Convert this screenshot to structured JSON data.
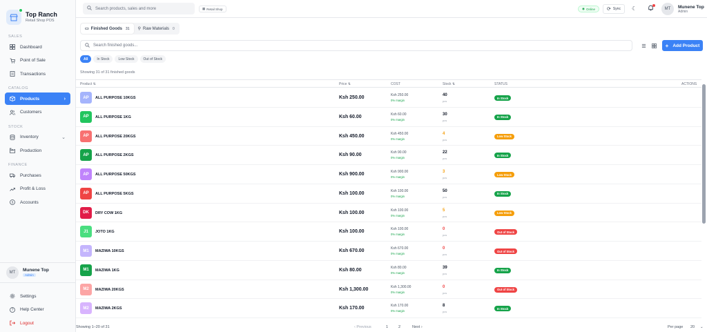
{
  "brand": {
    "title": "Top Ranch",
    "subtitle": "Retail Shop POS"
  },
  "sidebar": {
    "sections": [
      {
        "label": "SALES",
        "items": [
          {
            "label": "Dashboard",
            "icon": "dashboard-icon"
          },
          {
            "label": "Point of Sale",
            "icon": "cart-icon"
          },
          {
            "label": "Transactions",
            "icon": "receipt-icon"
          }
        ]
      },
      {
        "label": "CATALOG",
        "items": [
          {
            "label": "Products",
            "icon": "box-icon",
            "active": true
          },
          {
            "label": "Customers",
            "icon": "users-icon"
          }
        ]
      },
      {
        "label": "STOCK",
        "items": [
          {
            "label": "Inventory",
            "icon": "database-icon"
          },
          {
            "label": "Production",
            "icon": "factory-icon"
          }
        ]
      },
      {
        "label": "FINANCE",
        "items": [
          {
            "label": "Purchases",
            "icon": "truck-icon"
          },
          {
            "label": "Profit & Loss",
            "icon": "trend-icon"
          },
          {
            "label": "Accounts",
            "icon": "dollar-icon"
          }
        ]
      }
    ],
    "user": {
      "initials": "MT",
      "name": "Munene Top",
      "role": "Admin"
    },
    "bottom": {
      "settings": "Settings",
      "help": "Help Center",
      "logout": "Logout"
    }
  },
  "topbar": {
    "search_placeholder": "Search products, sales and more",
    "shop": "Retail Shop",
    "online": "Online",
    "sync": "Sync",
    "user": {
      "initials": "MT",
      "name": "Munene Top",
      "role": "Admin"
    }
  },
  "tabs": [
    {
      "label": "Finished Goods",
      "count": "31"
    },
    {
      "label": "Raw Materials",
      "count": "0"
    }
  ],
  "toolbar": {
    "search_placeholder": "Search finished goods...",
    "add_label": "Add Product"
  },
  "filters": [
    "All",
    "In Stock",
    "Low Stock",
    "Out of Stock"
  ],
  "showing_text": "Showing 31 of 31 finished goods",
  "table": {
    "headers": {
      "product": "Product ⇅",
      "price": "Price ⇅",
      "cost": "COST",
      "stock": "Stock ⇅",
      "status": "STATUS",
      "actions": "ACTIONS"
    },
    "rows": [
      {
        "initials": "AP",
        "color": "#a5b4fc",
        "name": "ALL PURPOSE 10KGS",
        "price": "Ksh 250.00",
        "cost": "Ksh 250.00",
        "margin": "0% margin",
        "stock": "40",
        "stock_color": "#111827",
        "unit": "pcs",
        "status": "In Stock",
        "status_color": "#16a34a"
      },
      {
        "initials": "AP",
        "color": "#22c55e",
        "name": "ALL PURPOSE 1KG",
        "price": "Ksh 60.00",
        "cost": "Ksh 60.00",
        "margin": "0% margin",
        "stock": "30",
        "stock_color": "#111827",
        "unit": "pcs",
        "status": "In Stock",
        "status_color": "#16a34a"
      },
      {
        "initials": "AP",
        "color": "#f87171",
        "name": "ALL PURPOSE 20KGS",
        "price": "Ksh 450.00",
        "cost": "Ksh 450.00",
        "margin": "0% margin",
        "stock": "4",
        "stock_color": "#f59e0b",
        "unit": "pcs",
        "status": "Low Stock",
        "status_color": "#f59e0b"
      },
      {
        "initials": "AP",
        "color": "#16a34a",
        "name": "ALL PURPOSE 2KGS",
        "price": "Ksh 90.00",
        "cost": "Ksh 90.00",
        "margin": "0% margin",
        "stock": "22",
        "stock_color": "#111827",
        "unit": "pcs",
        "status": "In Stock",
        "status_color": "#16a34a"
      },
      {
        "initials": "AP",
        "color": "#c084fc",
        "name": "ALL PURPOSE 50KGS",
        "price": "Ksh 900.00",
        "cost": "Ksh 900.00",
        "margin": "0% margin",
        "stock": "3",
        "stock_color": "#f59e0b",
        "unit": "pcs",
        "status": "Low Stock",
        "status_color": "#f59e0b"
      },
      {
        "initials": "AP",
        "color": "#ef4444",
        "name": "ALL PURPOSE 5KGS",
        "price": "Ksh 100.00",
        "cost": "Ksh 100.00",
        "margin": "0% margin",
        "stock": "50",
        "stock_color": "#111827",
        "unit": "pcs",
        "status": "In Stock",
        "status_color": "#16a34a"
      },
      {
        "initials": "DK",
        "color": "#e11d48",
        "name": "DRY COW 1KG",
        "price": "Ksh 100.00",
        "cost": "Ksh 100.00",
        "margin": "0% margin",
        "stock": "5",
        "stock_color": "#f59e0b",
        "unit": "pcs",
        "status": "Low Stock",
        "status_color": "#f59e0b"
      },
      {
        "initials": "J1",
        "color": "#4ade80",
        "name": "JOTO 1KG",
        "price": "Ksh 100.00",
        "cost": "Ksh 100.00",
        "margin": "0% margin",
        "stock": "0",
        "stock_color": "#ef4444",
        "unit": "pcs",
        "status": "Out of Stock",
        "status_color": "#ef4444"
      },
      {
        "initials": "M1",
        "color": "#c4b5fd",
        "name": "MAZIWA 10KGS",
        "price": "Ksh 670.00",
        "cost": "Ksh 670.00",
        "margin": "0% margin",
        "stock": "0",
        "stock_color": "#ef4444",
        "unit": "pcs",
        "status": "Out of Stock",
        "status_color": "#ef4444"
      },
      {
        "initials": "M1",
        "color": "#16a34a",
        "name": "MAZIWA 1KG",
        "price": "Ksh 80.00",
        "cost": "Ksh 80.00",
        "margin": "0% margin",
        "stock": "39",
        "stock_color": "#111827",
        "unit": "pcs",
        "status": "In Stock",
        "status_color": "#16a34a"
      },
      {
        "initials": "M2",
        "color": "#fca5a5",
        "name": "MAZIWA 20KGS",
        "price": "Ksh 1,300.00",
        "cost": "Ksh 1,300.00",
        "margin": "0% margin",
        "stock": "0",
        "stock_color": "#ef4444",
        "unit": "pcs",
        "status": "Out of Stock",
        "status_color": "#ef4444"
      },
      {
        "initials": "M2",
        "color": "#d8b4fe",
        "name": "MAZIWA 2KGS",
        "price": "Ksh 170.00",
        "cost": "Ksh 170.00",
        "margin": "0% margin",
        "stock": "8",
        "stock_color": "#111827",
        "unit": "pcs",
        "status": "In Stock",
        "status_color": "#16a34a"
      }
    ]
  },
  "footer": {
    "showing": "Showing 1–20 of 31",
    "previous": "‹ Previous",
    "page1": "1",
    "page2": "2",
    "next": "Next ›",
    "per_page_label": "Per page",
    "per_page_value": "20"
  }
}
